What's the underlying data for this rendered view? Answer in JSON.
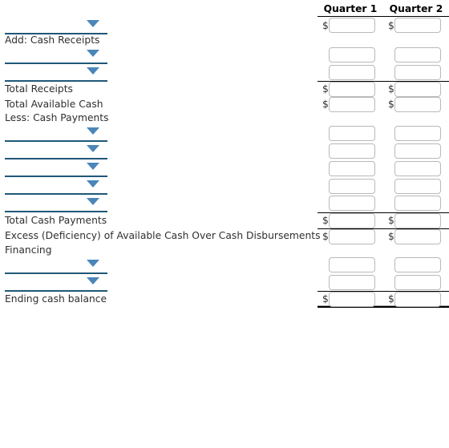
{
  "header": {
    "label_column": "",
    "columns": [
      "Quarter 1",
      "Quarter 2"
    ]
  },
  "select_placeholder": "",
  "currency_symbol": "$",
  "rows": [
    {
      "kind": "select",
      "label": "",
      "q1": "",
      "q2": "",
      "dollar": true,
      "rule": "none"
    },
    {
      "kind": "heading",
      "label": "Add: Cash Receipts",
      "q1": null,
      "q2": null
    },
    {
      "kind": "select",
      "label": "",
      "q1": "",
      "q2": "",
      "dollar": false,
      "rule": "none"
    },
    {
      "kind": "select",
      "label": "",
      "q1": "",
      "q2": "",
      "dollar": false,
      "rule": "bottom"
    },
    {
      "kind": "text",
      "label": "Total Receipts",
      "q1": "",
      "q2": "",
      "dollar": true,
      "rule": "none"
    },
    {
      "kind": "text",
      "label": "Total Available Cash",
      "q1": "",
      "q2": "",
      "dollar": true,
      "rule": "none"
    },
    {
      "kind": "heading",
      "label": "Less: Cash Payments",
      "q1": null,
      "q2": null
    },
    {
      "kind": "select",
      "label": "",
      "q1": "",
      "q2": "",
      "dollar": false,
      "rule": "none"
    },
    {
      "kind": "select",
      "label": "",
      "q1": "",
      "q2": "",
      "dollar": false,
      "rule": "none"
    },
    {
      "kind": "select",
      "label": "",
      "q1": "",
      "q2": "",
      "dollar": false,
      "rule": "none"
    },
    {
      "kind": "select",
      "label": "",
      "q1": "",
      "q2": "",
      "dollar": false,
      "rule": "none"
    },
    {
      "kind": "select",
      "label": "",
      "q1": "",
      "q2": "",
      "dollar": false,
      "rule": "bottom"
    },
    {
      "kind": "text",
      "label": "Total Cash Payments",
      "q1": "",
      "q2": "",
      "dollar": true,
      "rule": "bottom"
    },
    {
      "kind": "text",
      "label": "Excess (Deficiency) of Available Cash Over Cash Disbursements",
      "q1": "",
      "q2": "",
      "dollar": true,
      "rule": "none"
    },
    {
      "kind": "heading",
      "label": "Financing",
      "q1": null,
      "q2": null
    },
    {
      "kind": "select",
      "label": "",
      "q1": "",
      "q2": "",
      "dollar": false,
      "rule": "none"
    },
    {
      "kind": "select",
      "label": "",
      "q1": "",
      "q2": "",
      "dollar": false,
      "rule": "bottom"
    },
    {
      "kind": "text",
      "label": "Ending cash balance",
      "q1": "",
      "q2": "",
      "dollar": true,
      "rule": "double"
    }
  ]
}
